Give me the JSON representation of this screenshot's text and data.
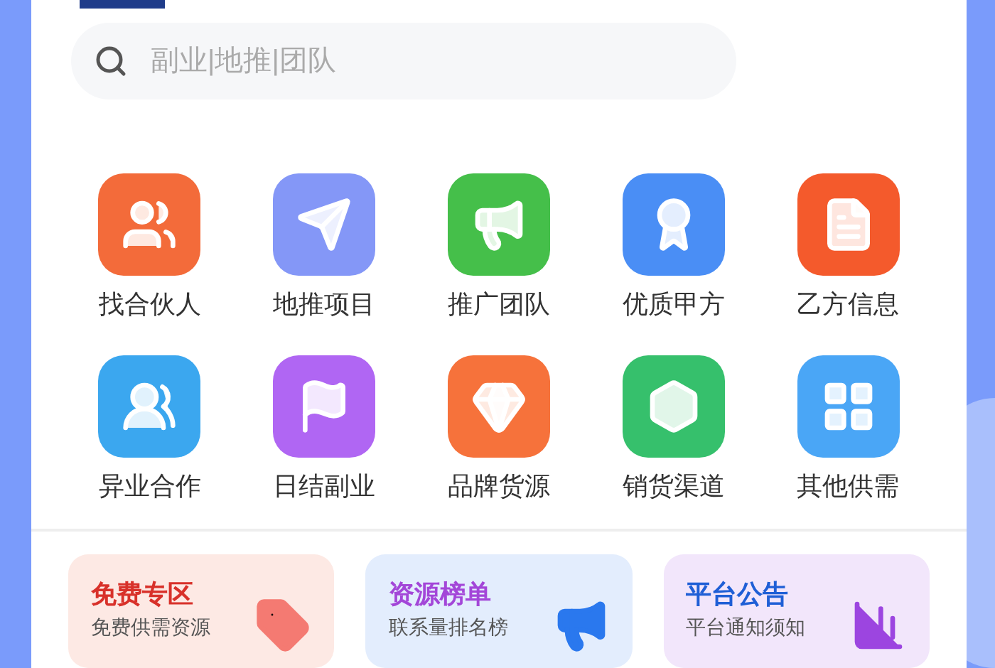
{
  "search": {
    "placeholder": "副业|地推|团队"
  },
  "grid": [
    {
      "label": "找合伙人",
      "kind": "people",
      "color": "#f36b3a"
    },
    {
      "label": "地推项目",
      "kind": "send",
      "color": "#8497f7"
    },
    {
      "label": "推广团队",
      "kind": "megaphone",
      "color": "#45bf4a"
    },
    {
      "label": "优质甲方",
      "kind": "badge",
      "color": "#4a8ef5"
    },
    {
      "label": "乙方信息",
      "kind": "document",
      "color": "#f45a2c"
    },
    {
      "label": "异业合作",
      "kind": "pair",
      "color": "#3ba7ef"
    },
    {
      "label": "日结副业",
      "kind": "flag",
      "color": "#b066f3"
    },
    {
      "label": "品牌货源",
      "kind": "gem",
      "color": "#f6723b"
    },
    {
      "label": "销货渠道",
      "kind": "hexagons",
      "color": "#36c06c"
    },
    {
      "label": "其他供需",
      "kind": "clover",
      "color": "#4aa6f6"
    }
  ],
  "cards": [
    {
      "title": "免费专区",
      "subtitle": "免费供需资源",
      "kind": "tag",
      "color": "#d8312a"
    },
    {
      "title": "资源榜单",
      "subtitle": "联系量排名榜",
      "kind": "megaphone",
      "color": "#a346d8"
    },
    {
      "title": "平台公告",
      "subtitle": "平台通知须知",
      "kind": "chart",
      "color": "#1f5fd6"
    }
  ]
}
